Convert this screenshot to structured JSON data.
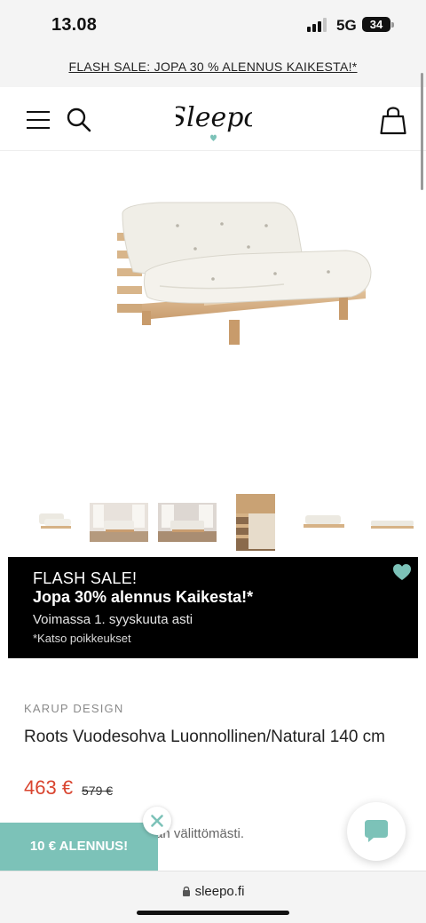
{
  "status_bar": {
    "time": "13.08",
    "network": "5G",
    "battery": "34"
  },
  "flash_banner": {
    "text": "FLASH SALE: JOPA 30 % ALENNUS KAIKESTA!*"
  },
  "header": {
    "logo_text": "Sleepo",
    "icons": [
      "menu-icon",
      "search-icon",
      "bag-icon"
    ]
  },
  "gallery": {
    "thumbnail_count": 6
  },
  "promo": {
    "title": "FLASH SALE!",
    "headline": "Jopa 30% alennus Kaikesta!*",
    "valid_until": "Voimassa 1. syyskuuta asti",
    "note": "*Katso poikkeukset"
  },
  "product": {
    "brand": "KARUP DESIGN",
    "title": "Roots Vuodesohva Luonnollinen/Natural 140 cm",
    "price": "463 €",
    "old_price": "579 €",
    "delivery_text": "an välittömästi."
  },
  "discount_tab": {
    "label": "10 € ALENNUS!"
  },
  "browser": {
    "url": "sleepo.fi"
  },
  "colors": {
    "accent_mint": "#7cc2b8",
    "price_red": "#d9442f",
    "promo_bg": "#000000"
  }
}
